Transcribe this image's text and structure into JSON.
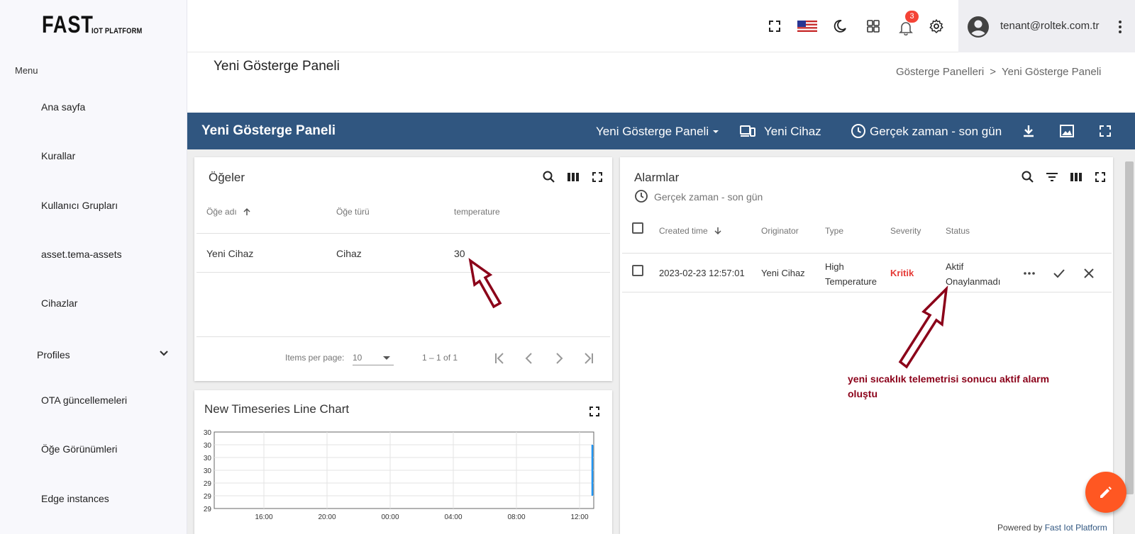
{
  "logo": {
    "big": "FAST",
    "small": "IOT PLATFORM"
  },
  "sidebar": {
    "menu_caption": "Menu",
    "items": [
      {
        "label": "Ana sayfa"
      },
      {
        "label": "Kurallar"
      },
      {
        "label": "Kullanıcı Grupları"
      },
      {
        "label": "asset.tema-assets"
      },
      {
        "label": "Cihazlar"
      },
      {
        "label": "Profiles"
      },
      {
        "label": "OTA güncellemeleri"
      },
      {
        "label": "Öğe Görünümleri"
      },
      {
        "label": "Edge instances"
      }
    ]
  },
  "topbar": {
    "notification_count": "3",
    "user_email": "tenant@roltek.com.tr"
  },
  "page": {
    "title": "Yeni Gösterge Paneli",
    "breadcrumb": [
      "Gösterge Panelleri",
      ">",
      "Yeni Gösterge Paneli"
    ]
  },
  "dashboard_bar": {
    "title": "Yeni Gösterge Paneli",
    "dashboard_select": "Yeni Gösterge Paneli",
    "entity": "Yeni Cihaz",
    "timewindow": "Gerçek zaman - son gün",
    "bg_color": "#305680"
  },
  "entities_widget": {
    "title": "Öğeler",
    "columns": [
      "Öğe adı",
      "Öğe türü",
      "temperature"
    ],
    "rows": [
      {
        "name": "Yeni Cihaz",
        "type": "Cihaz",
        "temperature": "30"
      }
    ],
    "paginator": {
      "items_per_page_label": "Items per page:",
      "page_size": "10",
      "range": "1 – 1 of 1"
    }
  },
  "chart_widget": {
    "title": "New Timeseries Line Chart"
  },
  "chart_data": {
    "type": "line",
    "title": "New Timeseries Line Chart",
    "y_tick_labels": [
      "30",
      "30",
      "30",
      "30",
      "29",
      "29",
      "29"
    ],
    "x_tick_labels": [
      "16:00",
      "20:00",
      "00:00",
      "04:00",
      "08:00",
      "12:00"
    ],
    "series": [
      {
        "values": [
          30,
          30
        ]
      }
    ],
    "grid": true,
    "series_color": "#2196f3"
  },
  "alarms_widget": {
    "title": "Alarmlar",
    "timewindow": "Gerçek zaman - son gün",
    "columns": [
      "Created time",
      "Originator",
      "Type",
      "Severity",
      "Status"
    ],
    "rows": [
      {
        "created": "2023-02-23 12:57:01",
        "originator": "Yeni Cihaz",
        "type_line1": "High",
        "type_line2": "Temperature",
        "severity": "Kritik",
        "status_line1": "Aktif",
        "status_line2": "Onaylanmadı"
      }
    ],
    "severity_color": "#e53935"
  },
  "annotation": {
    "text": "yeni sıcaklık telemetrisi sonucu aktif alarm oluştu",
    "color": "#8b0019"
  },
  "footer": {
    "powered_by": "Powered by",
    "platform": "Fast Iot Platform"
  }
}
